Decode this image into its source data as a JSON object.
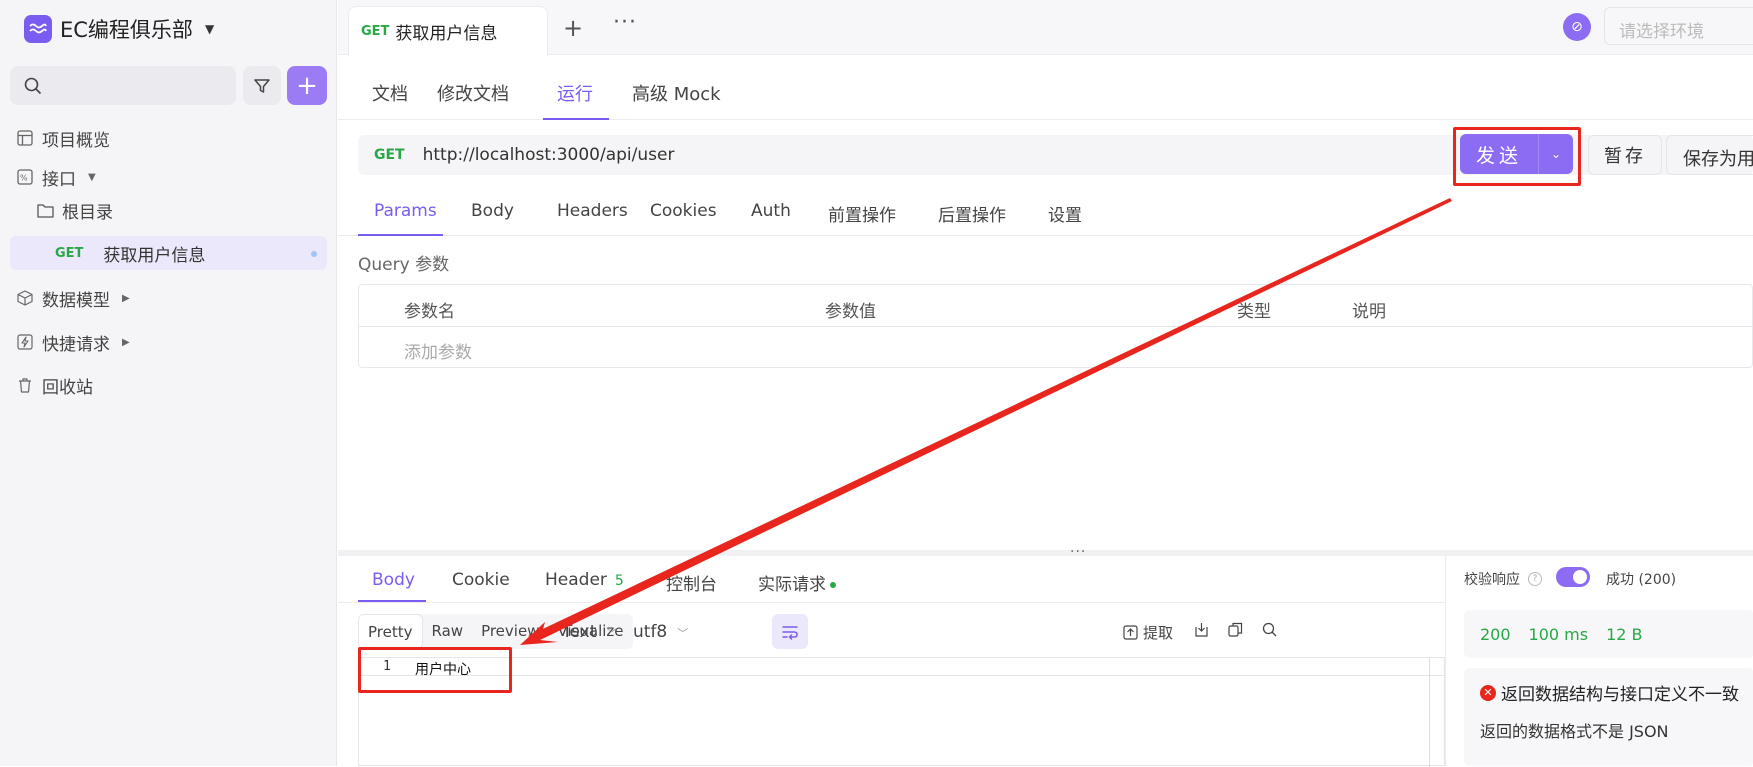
{
  "sidebar": {
    "team_name": "EC编程俱乐部",
    "nav": {
      "overview": "项目概览",
      "apis": "接口",
      "root": "根目录",
      "api_method": "GET",
      "api_name": "获取用户信息",
      "models": "数据模型",
      "quick": "快捷请求",
      "trash": "回收站"
    }
  },
  "tabbar": {
    "tab_method": "GET",
    "tab_title": "获取用户信息",
    "env_placeholder": "请选择环境"
  },
  "doc_tabs": [
    "文档",
    "修改文档",
    "运行",
    "高级 Mock"
  ],
  "url": {
    "method": "GET",
    "value": "http://localhost:3000/api/user"
  },
  "actions": {
    "send": "发送",
    "stash": "暂存",
    "save": "保存为用例"
  },
  "req_tabs": [
    "Params",
    "Body",
    "Headers",
    "Cookies",
    "Auth",
    "前置操作",
    "后置操作",
    "设置"
  ],
  "query": {
    "title": "Query 参数",
    "headers": [
      "参数名",
      "参数值",
      "类型",
      "说明"
    ],
    "add_placeholder": "添加参数"
  },
  "response": {
    "tabs": [
      "Body",
      "Cookie",
      "Header",
      "控制台",
      "实际请求"
    ],
    "header_count": "5",
    "formats": [
      "Pretty",
      "Raw",
      "Preview",
      "Visualize"
    ],
    "type": "Text",
    "encoding": "utf8",
    "extract": "提取",
    "line_number": "1",
    "code": "用户中心"
  },
  "validation": {
    "label": "校验响应",
    "result": "成功 (200)",
    "status": "200",
    "time": "100 ms",
    "size": "12 B",
    "error_title": "返回数据结构与接口定义不一致",
    "error_msg": "返回的数据格式不是 JSON"
  },
  "colors": {
    "accent": "#7b5cf0",
    "get": "#27a844",
    "annotation": "#e8261d"
  }
}
